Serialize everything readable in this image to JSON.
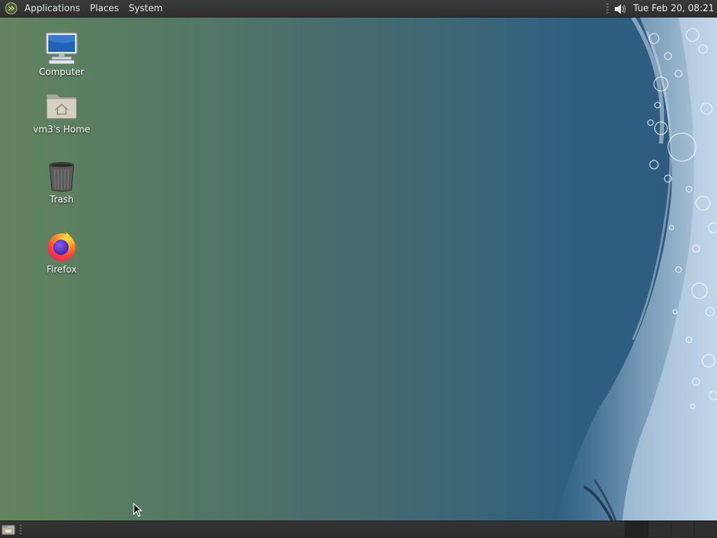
{
  "top_panel": {
    "menus": [
      "Applications",
      "Places",
      "System"
    ],
    "clock": "Tue Feb 20, 08:21"
  },
  "desktop": {
    "icons": [
      {
        "label": "Computer",
        "icon": "computer-icon"
      },
      {
        "label": "vm3's Home",
        "icon": "home-folder-icon"
      },
      {
        "label": "Trash",
        "icon": "trash-icon"
      },
      {
        "label": "Firefox",
        "icon": "firefox-icon"
      }
    ]
  },
  "bottom_panel": {
    "workspaces": 4,
    "active_workspace": 1
  },
  "colors": {
    "panel": "#2e2e2e",
    "desktop_left": "#62845e",
    "desktop_right": "#2e5b80"
  }
}
